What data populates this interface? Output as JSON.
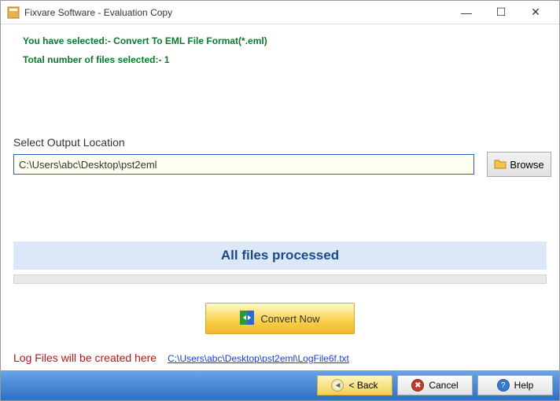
{
  "window": {
    "title": "Fixvare Software - Evaluation Copy"
  },
  "info": {
    "selected_format": "You have selected:- Convert To EML File Format(*.eml)",
    "file_count_text": "Total number of files selected:- 1"
  },
  "output": {
    "label": "Select Output Location",
    "path": "C:\\Users\\abc\\Desktop\\pst2eml",
    "browse_label": "Browse"
  },
  "status": {
    "message": "All files processed"
  },
  "actions": {
    "convert_label": "Convert Now"
  },
  "log": {
    "label": "Log Files will be created here",
    "path": "C:\\Users\\abc\\Desktop\\pst2eml\\LogFile6f.txt"
  },
  "footer": {
    "back_label": "< Back",
    "cancel_label": "Cancel",
    "help_label": "Help"
  }
}
